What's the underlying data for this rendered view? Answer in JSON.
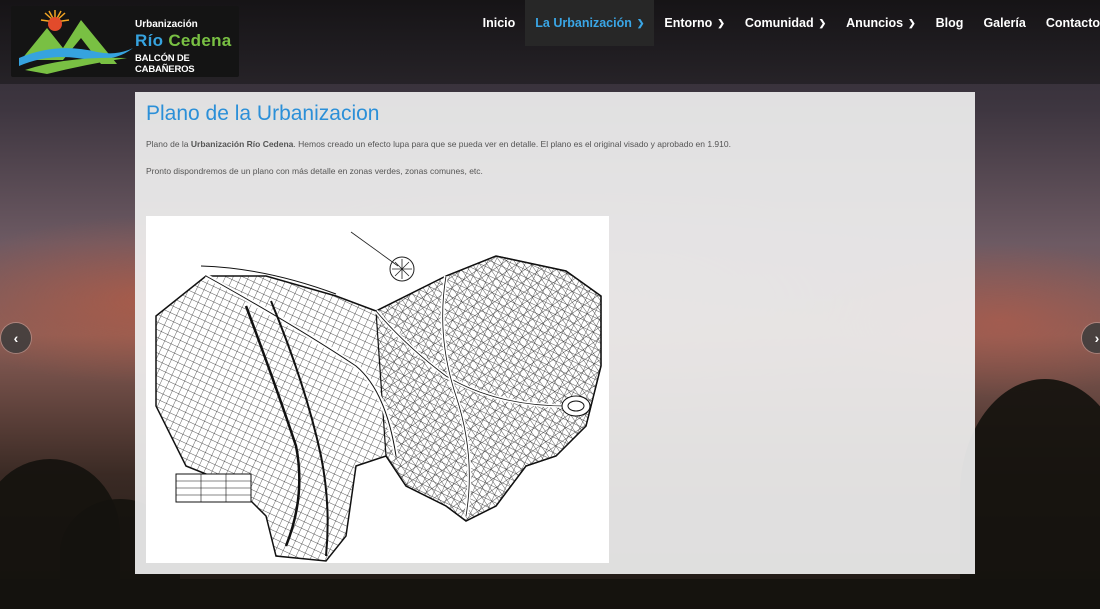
{
  "logo": {
    "line1": "Urbanización",
    "line2a": "Río",
    "line2b": "Cedena",
    "line3": "BALCÓN DE CABAÑEROS"
  },
  "menu": [
    {
      "label": "Inicio",
      "dropdown": false
    },
    {
      "label": "La Urbanización",
      "dropdown": true,
      "active": true
    },
    {
      "label": "Entorno",
      "dropdown": true
    },
    {
      "label": "Comunidad",
      "dropdown": true
    },
    {
      "label": "Anuncios",
      "dropdown": true
    },
    {
      "label": "Blog",
      "dropdown": false
    },
    {
      "label": "Galería",
      "dropdown": false
    },
    {
      "label": "Contacto",
      "dropdown": false
    }
  ],
  "page": {
    "title": "Plano de la Urbanizacion",
    "para1_pre": "Plano de la ",
    "para1_bold": "Urbanización Río Cedena",
    "para1_post": ". Hemos creado un efecto lupa para que se pueda ver en detalle. El plano es el original visado y aprobado en 1.910.",
    "para2": "Pronto dispondremos de un plano con más detalle en zonas verdes, zonas comunes, etc."
  },
  "slider": {
    "prev_symbol": "‹",
    "next_symbol": "›"
  },
  "colors": {
    "accent": "#2b8fd8",
    "logo_green": "#79c043",
    "logo_blue": "#36a3df"
  }
}
